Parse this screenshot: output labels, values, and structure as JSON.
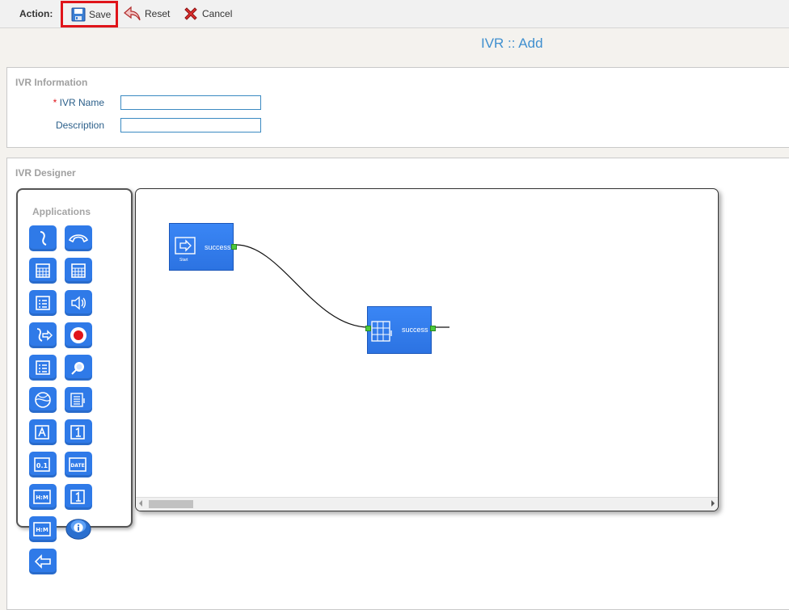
{
  "toolbar": {
    "action_label": "Action:",
    "save_label": "Save",
    "reset_label": "Reset",
    "cancel_label": "Cancel"
  },
  "page": {
    "title": "IVR :: Add"
  },
  "ivr_information": {
    "section_title": "IVR Information",
    "ivr_name_required": "*",
    "ivr_name_label": "IVR Name",
    "ivr_name_value": "",
    "description_label": "Description",
    "description_value": ""
  },
  "ivr_designer": {
    "section_title": "IVR Designer",
    "applications_title": "Applications",
    "applications": [
      "dial-icon",
      "hangup-icon",
      "calendar-icon",
      "calendar-2-icon",
      "menu-list-icon",
      "playback-icon",
      "transfer-icon",
      "record-icon",
      "menu-list-2-icon",
      "search-icon",
      "globe-icon",
      "keypad-icon",
      "say-alpha-icon",
      "say-digits-icon",
      "say-number-icon",
      "say-date-icon",
      "say-time-icon",
      "say-digit-2-icon",
      "say-time-2-icon",
      "info-icon",
      "back-icon"
    ],
    "nodes": [
      {
        "name": "start-node",
        "icon": "start-arrow-icon",
        "caption": "Start",
        "output": "success"
      },
      {
        "name": "keypad-node",
        "icon": "keypad-icon",
        "output": "success"
      }
    ]
  },
  "colors": {
    "accent": "#3f8fcf",
    "node_blue": "#2f7ae8",
    "port_green": "#4cc83b",
    "highlight_red": "#e0141a"
  }
}
